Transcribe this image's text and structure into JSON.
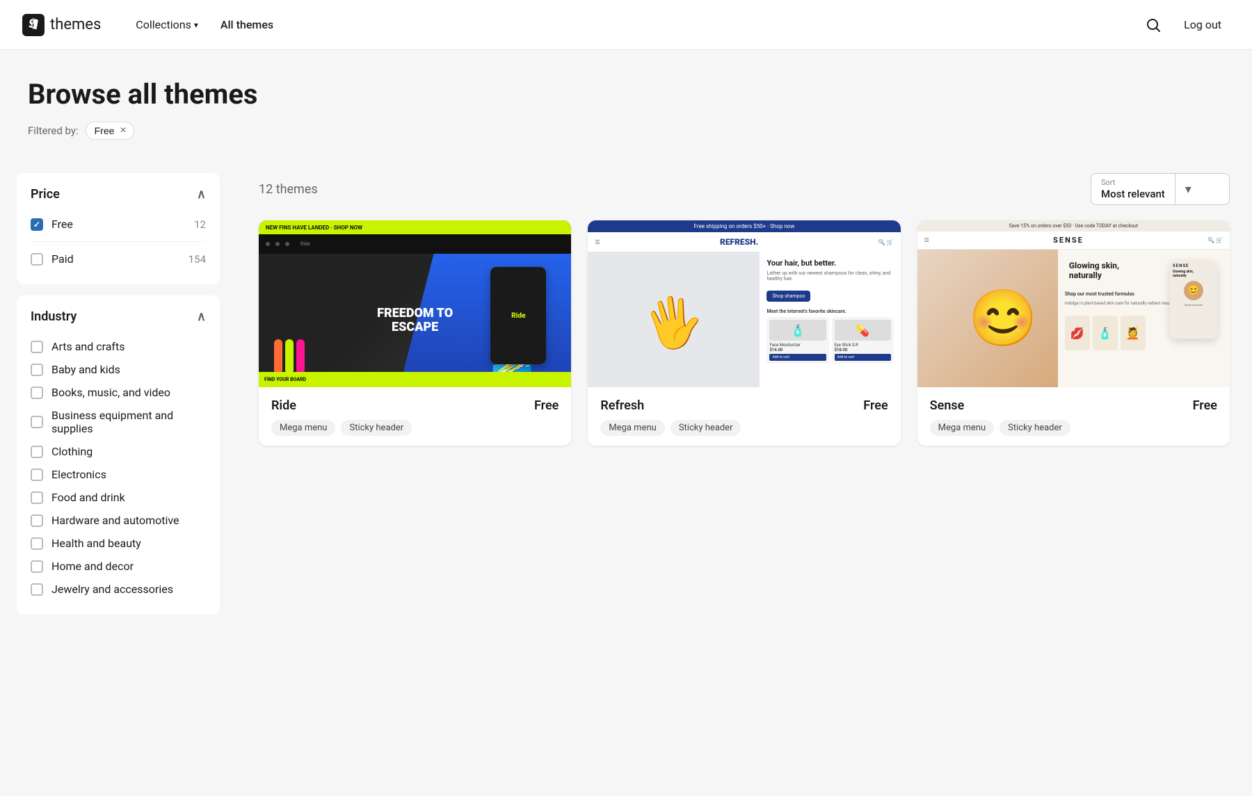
{
  "nav": {
    "logo_text": "themes",
    "collections_label": "Collections",
    "all_themes_label": "All themes",
    "logout_label": "Log out"
  },
  "hero": {
    "title": "Browse all themes",
    "filter_label": "Filtered by:",
    "active_filter": "Free",
    "filter_x": "×"
  },
  "sidebar": {
    "price_section": {
      "label": "Price",
      "items": [
        {
          "label": "Free",
          "count": "12",
          "checked": true
        },
        {
          "label": "Paid",
          "count": "154",
          "checked": false
        }
      ]
    },
    "industry_section": {
      "label": "Industry",
      "items": [
        {
          "label": "Arts and crafts",
          "checked": false
        },
        {
          "label": "Baby and kids",
          "checked": false
        },
        {
          "label": "Books, music, and video",
          "checked": false
        },
        {
          "label": "Business equipment and supplies",
          "checked": false
        },
        {
          "label": "Clothing",
          "checked": false
        },
        {
          "label": "Electronics",
          "checked": false
        },
        {
          "label": "Food and drink",
          "checked": false
        },
        {
          "label": "Hardware and automotive",
          "checked": false
        },
        {
          "label": "Health and beauty",
          "checked": false
        },
        {
          "label": "Home and decor",
          "checked": false
        },
        {
          "label": "Jewelry and accessories",
          "checked": false
        }
      ]
    }
  },
  "content": {
    "themes_count": "12 themes",
    "sort_label": "Sort",
    "sort_value": "Most relevant",
    "themes": [
      {
        "name": "Ride",
        "price": "Free",
        "tags": [
          "Mega menu",
          "Sticky header"
        ],
        "type": "ride"
      },
      {
        "name": "Refresh",
        "price": "Free",
        "tags": [
          "Mega menu",
          "Sticky header"
        ],
        "type": "refresh"
      },
      {
        "name": "Sense",
        "price": "Free",
        "tags": [
          "Mega menu",
          "Sticky header"
        ],
        "type": "sense"
      }
    ]
  }
}
